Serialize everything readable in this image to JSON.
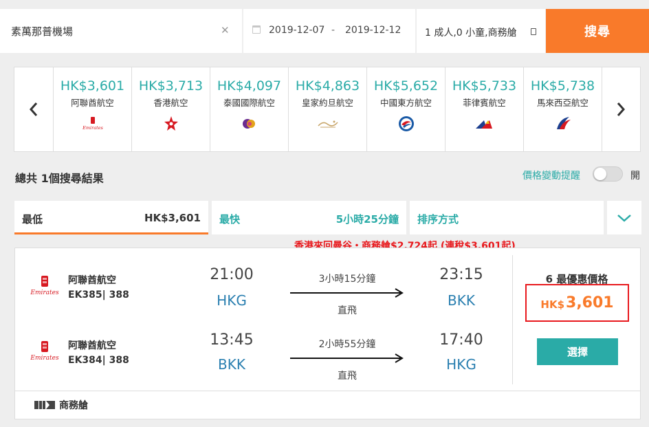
{
  "search": {
    "destination": "素萬那普機場",
    "date_from": "2019-12-07",
    "date_sep": "-",
    "date_to": "2019-12-12",
    "passengers": "1 成人,0 小童,商務艙",
    "search_label": "搜尋"
  },
  "carousel": [
    {
      "price": "HK$3,601",
      "airline": "阿聯酋航空",
      "logo": "emirates-logo"
    },
    {
      "price": "HK$3,713",
      "airline": "香港航空",
      "logo": "hong-kong-airlines-logo"
    },
    {
      "price": "HK$4,097",
      "airline": "泰國國際航空",
      "logo": "thai-airways-logo"
    },
    {
      "price": "HK$4,863",
      "airline": "皇家約旦航空",
      "logo": "royal-jordanian-logo"
    },
    {
      "price": "HK$5,652",
      "airline": "中國東方航空",
      "logo": "china-eastern-logo"
    },
    {
      "price": "HK$5,733",
      "airline": "菲律賓航空",
      "logo": "philippine-airlines-logo"
    },
    {
      "price": "HK$5,738",
      "airline": "馬來西亞航空",
      "logo": "malaysia-airlines-logo"
    }
  ],
  "results": {
    "total": "總共 1個搜尋結果",
    "price_alert": "價格變動提醒",
    "toggle_label": "開"
  },
  "sort": {
    "cheapest_label": "最低",
    "cheapest_value": "HK$3,601",
    "fastest_label": "最快",
    "fastest_value": "5小時25分鐘",
    "sort_label": "排序方式"
  },
  "promo": "香港來回曼谷・商務艙$2,724起 (連稅$3,601起)",
  "card": {
    "legs": [
      {
        "airline": "阿聯酋航空",
        "flight": "EK385| 388",
        "dep_time": "21:00",
        "dep_airport": "HKG",
        "duration": "3小時15分鐘",
        "stops": "直飛",
        "arr_time": "23:15",
        "arr_airport": "BKK"
      },
      {
        "airline": "阿聯酋航空",
        "flight": "EK384| 388",
        "dep_time": "13:45",
        "dep_airport": "BKK",
        "duration": "2小時55分鐘",
        "stops": "直飛",
        "arr_time": "17:40",
        "arr_airport": "HKG"
      }
    ],
    "price_title": "6 最優惠價格",
    "currency": "HK$",
    "price": "3,601",
    "select_label": "選擇",
    "cabin": "商務艙"
  },
  "colors": {
    "accent": "#f97a2a",
    "teal": "#2aaba7",
    "promo_red": "#e8181c",
    "airport_blue": "#2a7fb0"
  }
}
